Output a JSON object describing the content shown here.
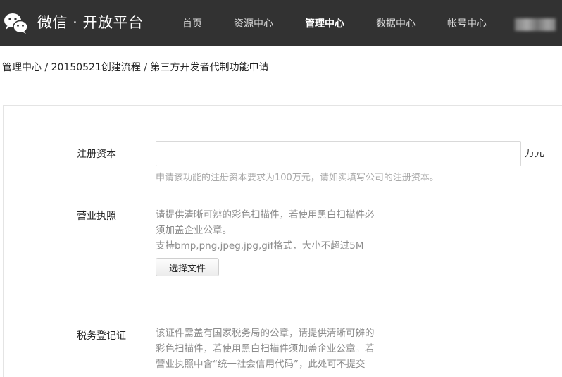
{
  "header": {
    "brand": "微信 · 开放平台",
    "logo_icon": "wechat-logo-icon",
    "nav": [
      {
        "label": "首页",
        "active": false
      },
      {
        "label": "资源中心",
        "active": false
      },
      {
        "label": "管理中心",
        "active": true
      },
      {
        "label": "数据中心",
        "active": false
      },
      {
        "label": "帐号中心",
        "active": false
      }
    ],
    "colors": {
      "bar": "#323232",
      "active": "#ffffff",
      "inactive": "#d9d9d9"
    }
  },
  "breadcrumb": "管理中心 / 20150521创建流程 / 第三方开发者代制功能申请",
  "form": {
    "capital": {
      "label": "注册资本",
      "value": "",
      "unit": "万元",
      "hint": "申请该功能的注册资本要求为100万元，请如实填写公司的注册资本。"
    },
    "license": {
      "label": "营业执照",
      "desc_lines": [
        "请提供清晰可辨的彩色扫描件，若使用黑白扫描件必",
        "须加盖企业公章。",
        "支持bmp,png,jpeg,jpg,gif格式，大小不超过5M"
      ],
      "button_label": "选择文件"
    },
    "tax": {
      "label": "税务登记证",
      "desc_lines": [
        "该证件需盖有国家税务局的公章，请提供清晰可辨的",
        "彩色扫描件，若使用黑白扫描件须加盖企业公章。若",
        "营业执照中含“统一社会信用代码”，此处可不提交"
      ]
    }
  }
}
